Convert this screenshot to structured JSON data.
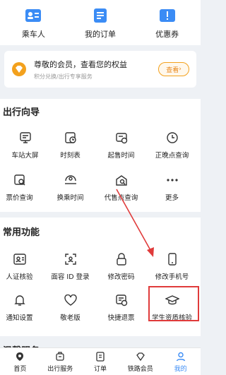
{
  "top_links": [
    {
      "label": "乘车人",
      "icon": "passenger-icon"
    },
    {
      "label": "我的订单",
      "icon": "order-icon"
    },
    {
      "label": "优惠券",
      "icon": "coupon-icon"
    }
  ],
  "member": {
    "title": "尊敬的会员，查看您的权益",
    "subtitle": "积分兑换/出行专享服务",
    "button": "查看"
  },
  "travel_guide": {
    "title": "出行向导",
    "items": [
      {
        "label": "车站大屏",
        "icon": "screen-icon"
      },
      {
        "label": "时刻表",
        "icon": "timetable-icon"
      },
      {
        "label": "起售时间",
        "icon": "sale-time-icon"
      },
      {
        "label": "正晚点查询",
        "icon": "clock-icon"
      },
      {
        "label": "票价查询",
        "icon": "fare-icon"
      },
      {
        "label": "换乘时间",
        "icon": "transfer-icon"
      },
      {
        "label": "代售点查询",
        "icon": "agency-icon"
      },
      {
        "label": "更多",
        "icon": "more-icon"
      }
    ]
  },
  "common": {
    "title": "常用功能",
    "items": [
      {
        "label": "人证核验",
        "icon": "id-verify-icon"
      },
      {
        "label": "面容 ID 登录",
        "icon": "face-id-icon"
      },
      {
        "label": "修改密码",
        "icon": "lock-icon"
      },
      {
        "label": "修改手机号",
        "icon": "phone-icon"
      },
      {
        "label": "通知设置",
        "icon": "bell-icon"
      },
      {
        "label": "敬老版",
        "icon": "heart-icon"
      },
      {
        "label": "快捷退票",
        "icon": "refund-icon"
      },
      {
        "label": "学生资质核验",
        "icon": "graduation-cap-icon"
      }
    ]
  },
  "next_section_partial": "温馨服务",
  "tabbar": [
    {
      "label": "首页",
      "icon": "home-icon"
    },
    {
      "label": "出行服务",
      "icon": "service-icon"
    },
    {
      "label": "订单",
      "icon": "order-tab-icon"
    },
    {
      "label": "铁路会员",
      "icon": "member-icon"
    },
    {
      "label": "我的",
      "icon": "profile-icon",
      "active": true
    }
  ],
  "colors": {
    "accent": "#3b8cf5",
    "highlight": "#e03b3b",
    "member": "#f3a11d"
  }
}
